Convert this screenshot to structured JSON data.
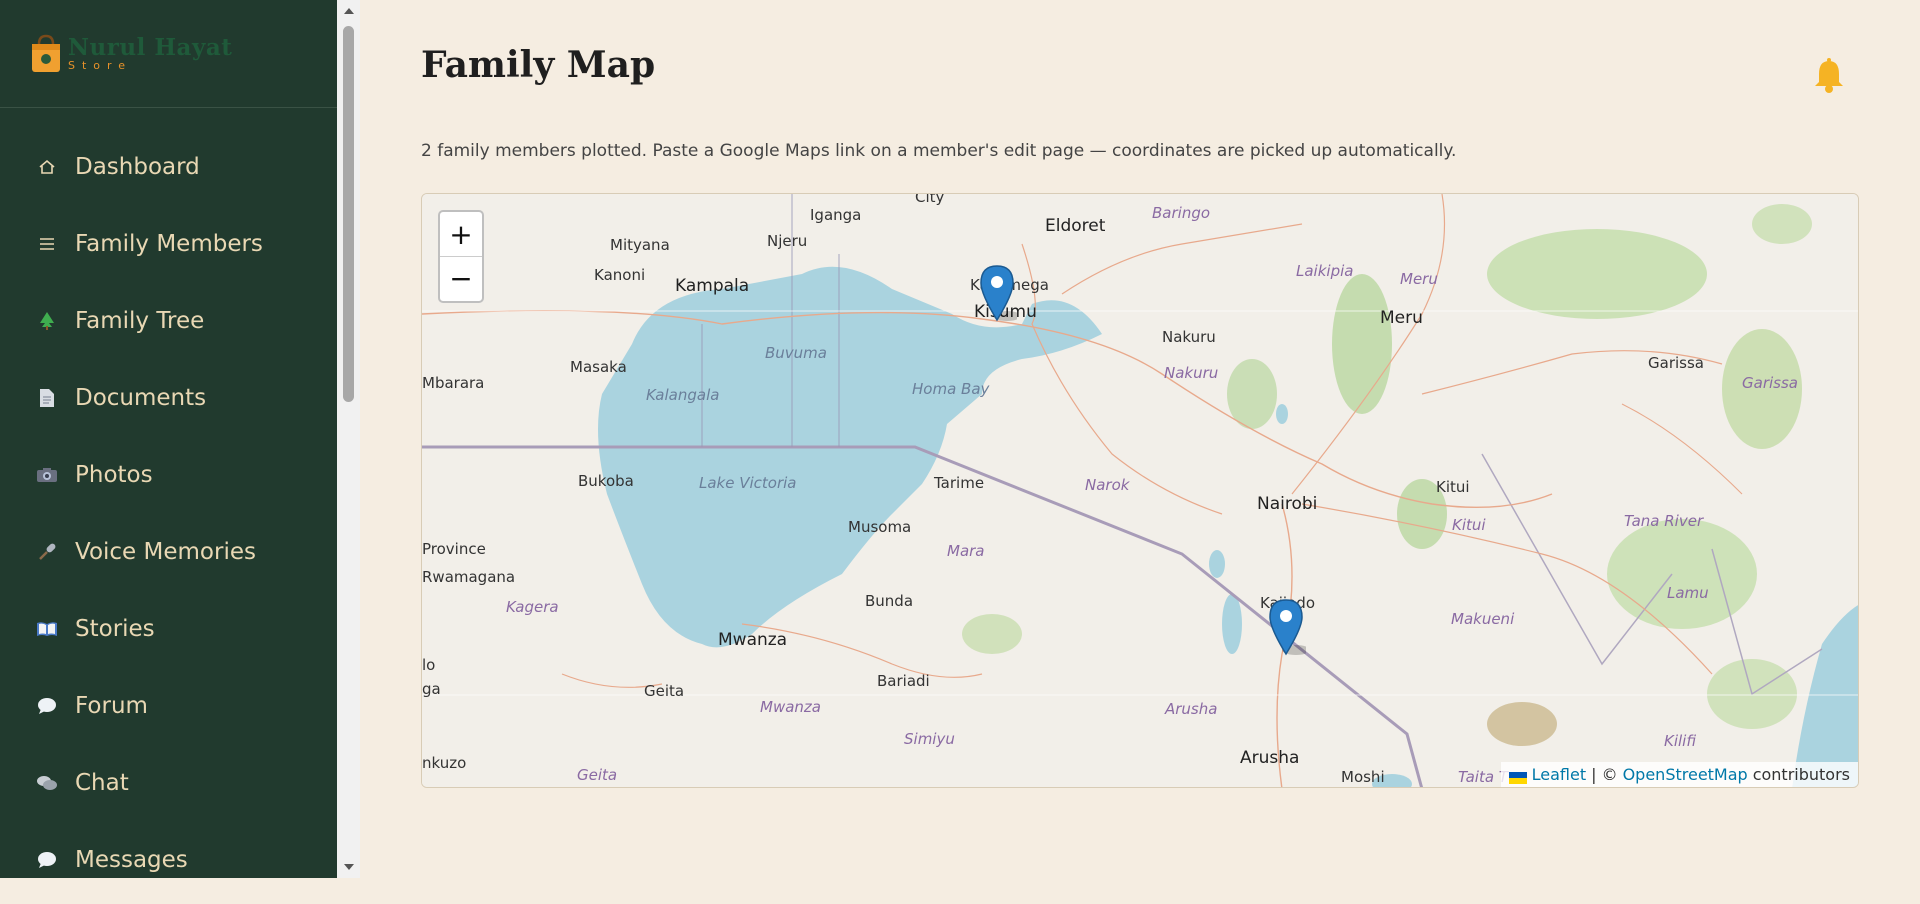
{
  "brand": {
    "name": "Nurul Hayat",
    "sub": "Store"
  },
  "sidebar": {
    "items": [
      {
        "label": "Dashboard",
        "icon": "home-icon"
      },
      {
        "label": "Family Members",
        "icon": "list-icon"
      },
      {
        "label": "Family Tree",
        "icon": "tree-icon"
      },
      {
        "label": "Documents",
        "icon": "document-icon"
      },
      {
        "label": "Photos",
        "icon": "camera-icon"
      },
      {
        "label": "Voice Memories",
        "icon": "microphone-icon"
      },
      {
        "label": "Stories",
        "icon": "book-icon"
      },
      {
        "label": "Forum",
        "icon": "speech-bubble-icon"
      },
      {
        "label": "Chat",
        "icon": "chat-bubbles-icon"
      },
      {
        "label": "Messages",
        "icon": "message-icon"
      }
    ]
  },
  "header": {
    "title": "Family Map",
    "subtitle": "2 family members plotted. Paste a Google Maps link on a member's edit page — coordinates are picked up automatically."
  },
  "map": {
    "zoom_in": "+",
    "zoom_out": "−",
    "attribution": {
      "leaflet": "Leaflet",
      "sep": "| ©",
      "osm": "OpenStreetMap",
      "tail": "contributors"
    },
    "labels": [
      {
        "text": "City"
      },
      {
        "text": "Eldoret"
      },
      {
        "text": "Baringo"
      },
      {
        "text": "Iganga"
      },
      {
        "text": "Njeru"
      },
      {
        "text": "Mityana"
      },
      {
        "text": "Kanoni"
      },
      {
        "text": "Kampala"
      },
      {
        "text": "Kakamega"
      },
      {
        "text": "Kisumu"
      },
      {
        "text": "Laikipia"
      },
      {
        "text": "Meru"
      },
      {
        "text": "Meru"
      },
      {
        "text": "Masaka"
      },
      {
        "text": "Buvuma"
      },
      {
        "text": "Kalangala"
      },
      {
        "text": "Homa Bay"
      },
      {
        "text": "Nakuru"
      },
      {
        "text": "Nakuru"
      },
      {
        "text": "Garissa"
      },
      {
        "text": "Garissa"
      },
      {
        "text": "Mbarara"
      },
      {
        "text": "Bukoba"
      },
      {
        "text": "Lake Victoria"
      },
      {
        "text": "Tarime"
      },
      {
        "text": "Narok"
      },
      {
        "text": "Nairobi"
      },
      {
        "text": "Kitui"
      },
      {
        "text": "Kitui"
      },
      {
        "text": "Musoma"
      },
      {
        "text": "Mara"
      },
      {
        "text": "Province"
      },
      {
        "text": "Rwamagana"
      },
      {
        "text": "Tana River"
      },
      {
        "text": "Kagera"
      },
      {
        "text": "Bunda"
      },
      {
        "text": "Kajiado"
      },
      {
        "text": "Makueni"
      },
      {
        "text": "Lamu"
      },
      {
        "text": "Mwanza"
      },
      {
        "text": "Bariadi"
      },
      {
        "text": "Geita"
      },
      {
        "text": "Mwanza"
      },
      {
        "text": "Arusha"
      },
      {
        "text": "Simiyu"
      },
      {
        "text": "Geita"
      },
      {
        "text": "Arusha"
      },
      {
        "text": "Moshi"
      },
      {
        "text": "Taita T"
      },
      {
        "text": "Kilifi"
      },
      {
        "text": "nkuzo"
      },
      {
        "text": "lo"
      },
      {
        "text": "ga"
      }
    ]
  },
  "colors": {
    "sidebar": "#213a2e",
    "accent": "#e9d8b4",
    "background": "#f5ede1",
    "marker": "#2a81cb",
    "bell": "#f5b324"
  }
}
